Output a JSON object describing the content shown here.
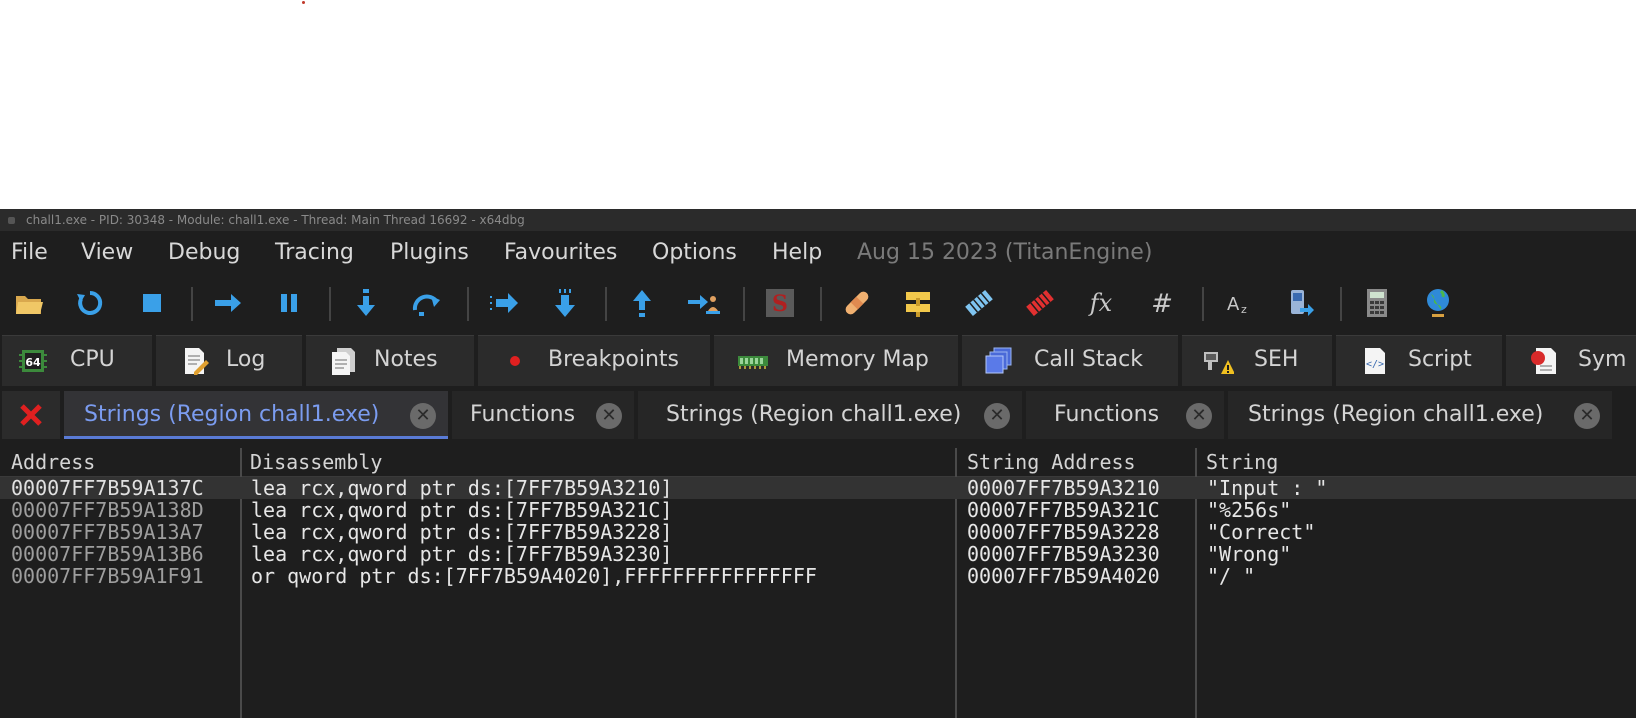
{
  "titlebar": {
    "title": "chall1.exe - PID: 30348 - Module: chall1.exe - Thread: Main Thread 16692 - x64dbg"
  },
  "menu": {
    "items": [
      "File",
      "View",
      "Debug",
      "Tracing",
      "Plugins",
      "Favourites",
      "Options",
      "Help"
    ],
    "build": "Aug 15 2023 (TitanEngine)"
  },
  "toolbar": {
    "icons": [
      "open-icon",
      "restart-icon",
      "stop-icon",
      "run-icon",
      "pause-icon",
      "step-into-icon",
      "step-over-icon",
      "trace-into-icon",
      "trace-over-icon",
      "execute-till-return-icon",
      "run-to-user-code-icon",
      "scylla-icon",
      "patches-icon",
      "comments-icon",
      "labels-icon",
      "bookmarks-icon",
      "functions-icon",
      "variables-icon",
      "strings-icon",
      "calls-icon",
      "calculator-icon",
      "web-icon"
    ]
  },
  "tabs": [
    {
      "label": "CPU",
      "icon": "cpu-icon"
    },
    {
      "label": "Log",
      "icon": "log-icon"
    },
    {
      "label": "Notes",
      "icon": "notes-icon"
    },
    {
      "label": "Breakpoints",
      "icon": "breakpoint-icon"
    },
    {
      "label": "Memory Map",
      "icon": "memory-map-icon"
    },
    {
      "label": "Call Stack",
      "icon": "call-stack-icon"
    },
    {
      "label": "SEH",
      "icon": "seh-icon"
    },
    {
      "label": "Script",
      "icon": "script-icon"
    },
    {
      "label": "Sym",
      "icon": "symbols-icon"
    }
  ],
  "subtabs": [
    {
      "label": "Strings (Region chall1.exe)",
      "active": true
    },
    {
      "label": "Functions",
      "active": false
    },
    {
      "label": "Strings (Region chall1.exe)",
      "active": false
    },
    {
      "label": "Functions",
      "active": false
    },
    {
      "label": "Strings (Region chall1.exe)",
      "active": false
    }
  ],
  "subtab_close_glyph": "✕",
  "table": {
    "headers": [
      "Address",
      "Disassembly",
      "String Address",
      "String"
    ],
    "rows": [
      {
        "address": "00007FF7B59A137C",
        "disassembly": "lea rcx,qword ptr ds:[7FF7B59A3210]",
        "string_address": "00007FF7B59A3210",
        "string": "\"Input : \""
      },
      {
        "address": "00007FF7B59A138D",
        "disassembly": "lea rcx,qword ptr ds:[7FF7B59A321C]",
        "string_address": "00007FF7B59A321C",
        "string": "\"%256s\""
      },
      {
        "address": "00007FF7B59A13A7",
        "disassembly": "lea rcx,qword ptr ds:[7FF7B59A3228]",
        "string_address": "00007FF7B59A3228",
        "string": "\"Correct\""
      },
      {
        "address": "00007FF7B59A13B6",
        "disassembly": "lea rcx,qword ptr ds:[7FF7B59A3230]",
        "string_address": "00007FF7B59A3230",
        "string": "\"Wrong\""
      },
      {
        "address": "00007FF7B59A1F91",
        "disassembly": "or qword ptr ds:[7FF7B59A4020],FFFFFFFFFFFFFFFF",
        "string_address": "00007FF7B59A4020",
        "string": "\"/ \""
      }
    ],
    "selected_row": 0
  },
  "colors": {
    "background": "#1e1e1e",
    "active_tab_accent": "#5a7bd6",
    "active_tab_text": "#7b9cf0"
  }
}
